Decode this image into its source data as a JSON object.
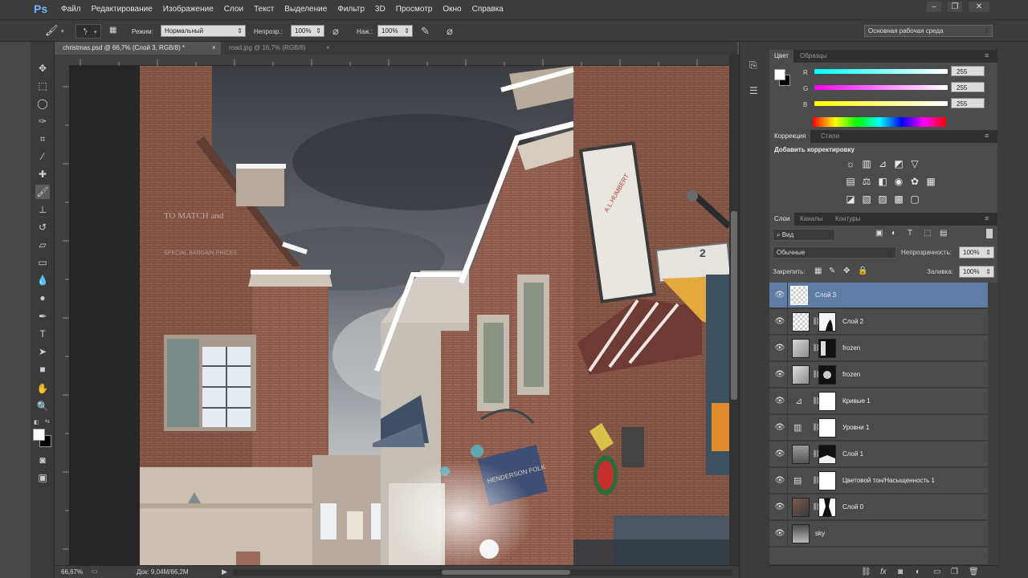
{
  "app": {
    "logo": "Ps"
  },
  "menu": [
    "Файл",
    "Редактирование",
    "Изображение",
    "Слои",
    "Текст",
    "Выделение",
    "Фильтр",
    "3D",
    "Просмотр",
    "Окно",
    "Справка"
  ],
  "window_controls": {
    "minimize": "–",
    "restore": "❐",
    "close": "✕"
  },
  "options": {
    "brush_size": "7",
    "mode_label": "Режим:",
    "mode_value": "Нормальный",
    "opacity_label": "Непрозр.:",
    "opacity_value": "100%",
    "flow_label": "Наж.:",
    "flow_value": "100%",
    "workspace": "Основная рабочая среда"
  },
  "doc_tabs": [
    {
      "title": "christmas.psd @ 66,7% (Слой 3, RGB/8) *",
      "close": "×"
    },
    {
      "title": "road.jpg @ 16,7% (RGB/8)",
      "close": "×"
    }
  ],
  "status": {
    "zoom": "66,67%",
    "doc": "Док: 9,04М/66,2М"
  },
  "color_panel": {
    "tabs": [
      "Цвет",
      "Образцы"
    ],
    "channels": [
      {
        "label": "R",
        "value": "255",
        "color": "#3ee0e8"
      },
      {
        "label": "G",
        "value": "255",
        "color": "#e04ad8"
      },
      {
        "label": "B",
        "value": "255",
        "color": "#e8e232"
      }
    ]
  },
  "adjustments_panel": {
    "tabs": [
      "Коррекция",
      "Стили"
    ],
    "title": "Добавить корректировку"
  },
  "layers_panel": {
    "tabs": [
      "Слои",
      "Каналы",
      "Контуры"
    ],
    "filter_value": "Вид",
    "blend_mode": "Обычные",
    "opacity_label": "Непрозрачность:",
    "opacity_value": "100%",
    "lock_label": "Закрепить:",
    "fill_label": "Заливка:",
    "fill_value": "100%",
    "layers": [
      {
        "name": "Слой 3",
        "selected": true
      },
      {
        "name": "Слой 2"
      },
      {
        "name": "frozen"
      },
      {
        "name": "frozen"
      },
      {
        "name": "Кривые 1"
      },
      {
        "name": "Уровни 1"
      },
      {
        "name": "Слой 1"
      },
      {
        "name": "Цветовой тон/Насыщенность 1"
      },
      {
        "name": "Слой 0"
      },
      {
        "name": "sky"
      }
    ]
  },
  "canvas_signs": {
    "sign_number": "2"
  },
  "accent_colors": {
    "selected_layer": "#5e7ca4",
    "app_bg": "#535353"
  }
}
